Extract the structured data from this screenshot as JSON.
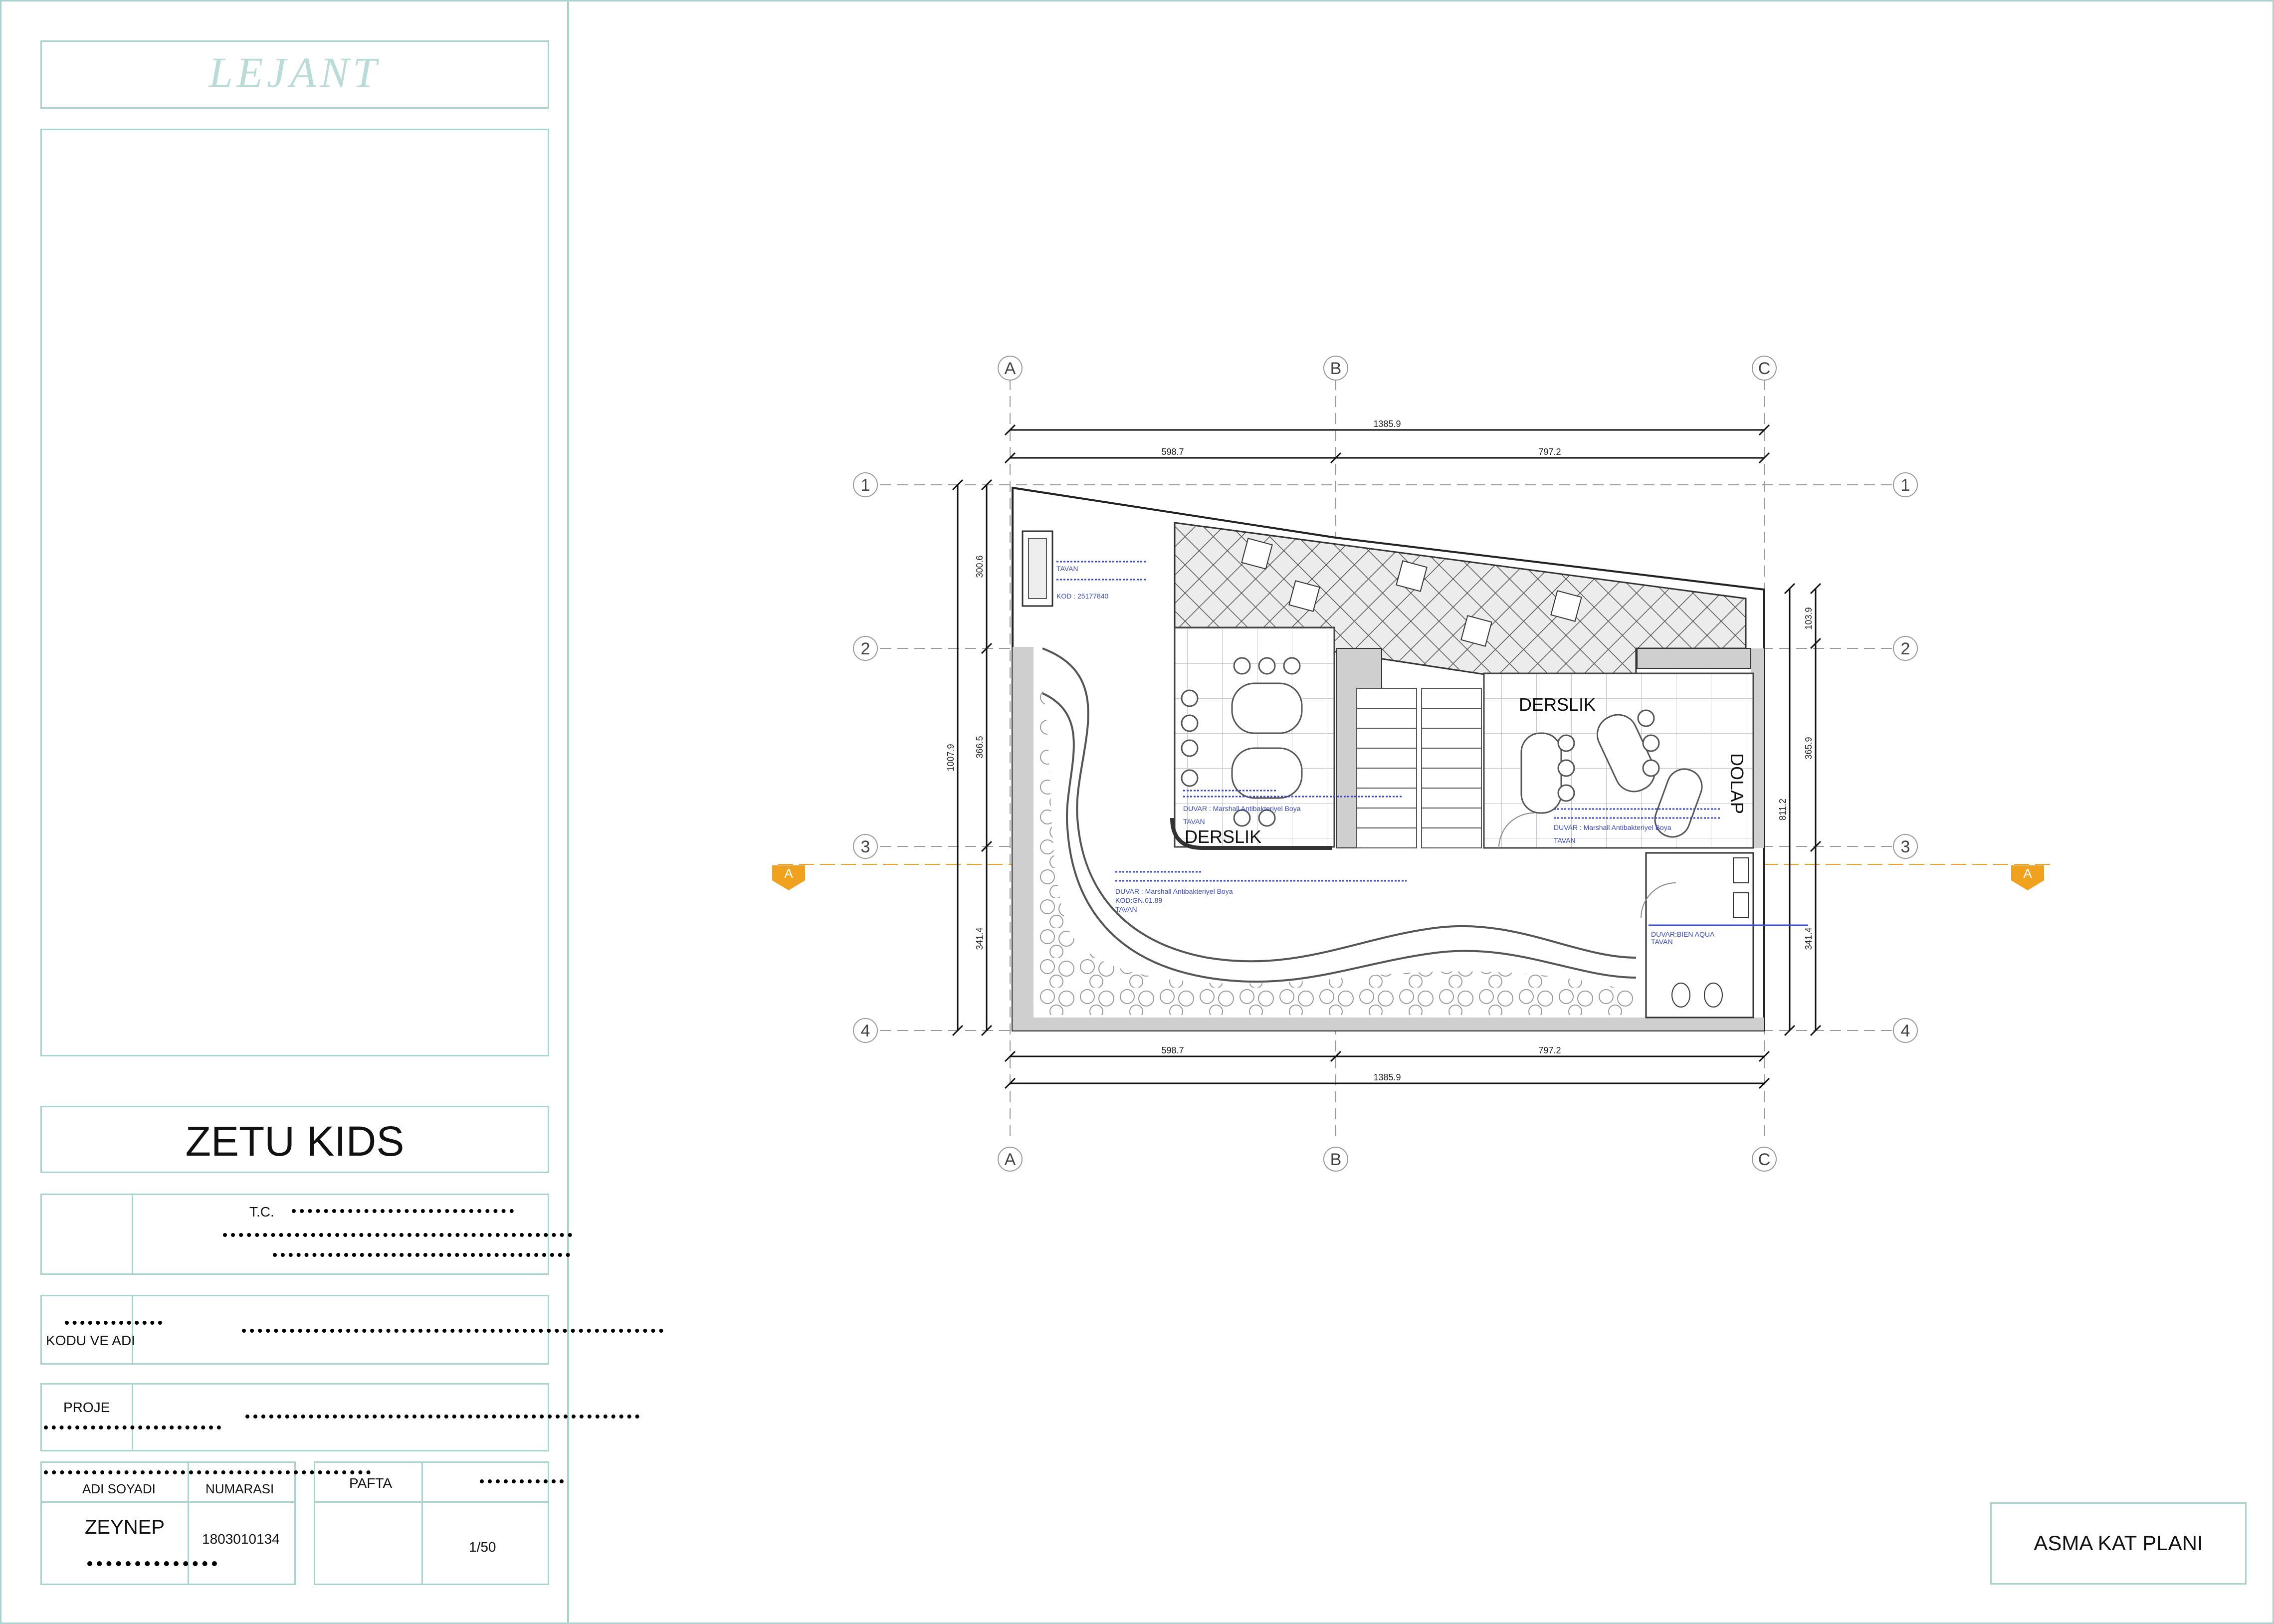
{
  "legend": {
    "title": "LEJANT"
  },
  "project_name": "ZETU KIDS",
  "title_block": {
    "tc_label": "T.C.",
    "code_label": "KODU VE ADI",
    "project_label": "PROJE",
    "name_label": "ADI SOYADI",
    "number_label": "NUMARASI",
    "student_name": "ZEYNEP",
    "student_number": "1803010134",
    "sheet_label": "PAFTA",
    "scale": "1/50",
    "drawing_title": "ASMA KAT PLANI"
  },
  "plan": {
    "grid_columns": [
      "A",
      "B",
      "C"
    ],
    "grid_rows": [
      "1",
      "2",
      "3",
      "4"
    ],
    "section_marker": "A",
    "dims_top": {
      "total": "1385.9",
      "left": "598.7",
      "right": "797.2"
    },
    "dims_bottom": {
      "total": "1385.9",
      "left": "598.7",
      "right": "797.2"
    },
    "dims_left": {
      "total": "1007.9",
      "top": "300.6",
      "middle": "366.5",
      "bottom": "341.4"
    },
    "dims_right": {
      "total": "811.2",
      "top": "103.9",
      "middle": "365.9",
      "bottom": "341.4"
    },
    "rooms": [
      "DERSLIK",
      "DERSLIK",
      "DOLAP"
    ],
    "notes": {
      "n1": "TAVAN",
      "n2": "KOD : 25177840",
      "n3": "DUVAR : Marshall Antibakteriyel Boya",
      "n4": "TAVAN",
      "n5": "DUVAR : Marshall Antibakteriyel Boya",
      "n6": "TAVAN",
      "n7": "DUVAR : Marshall Antibakteriyel Boya",
      "n8": "KOD:GN.01.89",
      "n9": "TAVAN",
      "n10": "DUVAR:BIEN AQUA",
      "n11": "TAVAN"
    }
  },
  "colors": {
    "frame": "#a9d3cf",
    "note": "#3b4bc8",
    "marker": "#f0a11e",
    "pattern_fill": "#d9d9d9"
  }
}
